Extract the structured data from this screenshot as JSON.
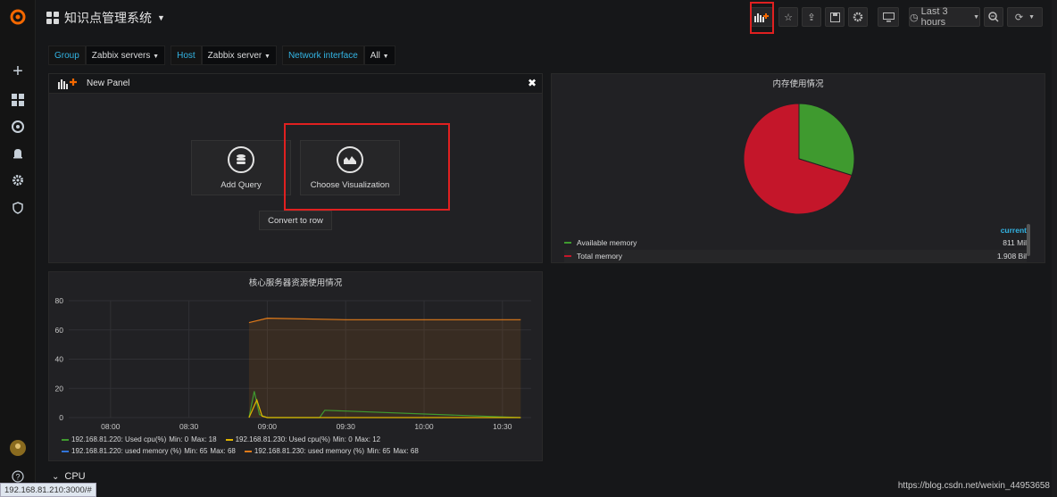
{
  "dashboard": {
    "title": "知识点管理系统"
  },
  "topbar": {
    "time_range": "Last 3 hours"
  },
  "variables": [
    {
      "label": "Group",
      "value": "Zabbix servers"
    },
    {
      "label": "Host",
      "value": "Zabbix server"
    },
    {
      "label": "Network interface",
      "value": "All"
    }
  ],
  "new_panel": {
    "title": "New Panel",
    "add_query": "Add Query",
    "choose_viz": "Choose Visualization",
    "convert_row": "Convert to row"
  },
  "pie_panel": {
    "title": "内存使用情况",
    "legend_header": "current",
    "colors": {
      "available": "#3f9a2f",
      "total": "#c4162a"
    },
    "items": [
      {
        "label": "Available memory",
        "value": "811 Mil"
      },
      {
        "label": "Total memory",
        "value": "1.908 Bil"
      }
    ]
  },
  "graph_panel": {
    "title": "核心服务器资源使用情况",
    "legend": [
      [
        {
          "label": "192.168.81.220: Used cpu(%)",
          "min": "Min: 0",
          "max": "Max: 18",
          "color": "#3f9a2f"
        },
        {
          "label": "192.168.81.230: Used cpu(%)",
          "min": "Min: 0",
          "max": "Max: 12",
          "color": "#e0b400"
        }
      ],
      [
        {
          "label": "192.168.81.220: used memory (%)",
          "min": "Min: 65",
          "max": "Max: 68",
          "color": "#3274d9"
        },
        {
          "label": "192.168.81.230: used memory (%)",
          "min": "Min: 65",
          "max": "Max: 68",
          "color": "#e07a1a"
        }
      ]
    ]
  },
  "chart_data": {
    "type": "line",
    "title": "核心服务器资源使用情况",
    "x_ticks": [
      "08:00",
      "08:30",
      "09:00",
      "09:30",
      "10:00",
      "10:30"
    ],
    "ylim": [
      0,
      80
    ],
    "y_ticks": [
      0,
      20,
      40,
      60,
      80
    ],
    "series": [
      {
        "name": "192.168.81.230: used memory (%)",
        "x": [
          "08:53",
          "09:00",
          "09:30",
          "10:00",
          "10:30",
          "10:37"
        ],
        "y": [
          65,
          68,
          67,
          67,
          67,
          67
        ]
      },
      {
        "name": "192.168.81.220: Used cpu(%)",
        "x": [
          "08:53",
          "08:55",
          "08:57",
          "09:00",
          "09:20",
          "09:22",
          "10:37"
        ],
        "y": [
          0,
          18,
          2,
          0,
          0,
          5,
          0
        ]
      },
      {
        "name": "192.168.81.230: Used cpu(%)",
        "x": [
          "08:53",
          "08:56",
          "08:58",
          "09:00",
          "10:37"
        ],
        "y": [
          0,
          12,
          1,
          0,
          0
        ]
      }
    ]
  },
  "cpu_row": {
    "title": "CPU"
  },
  "status_bar": {
    "url": "192.168.81.210:3000/#"
  },
  "watermark": "https://blog.csdn.net/weixin_44953658"
}
